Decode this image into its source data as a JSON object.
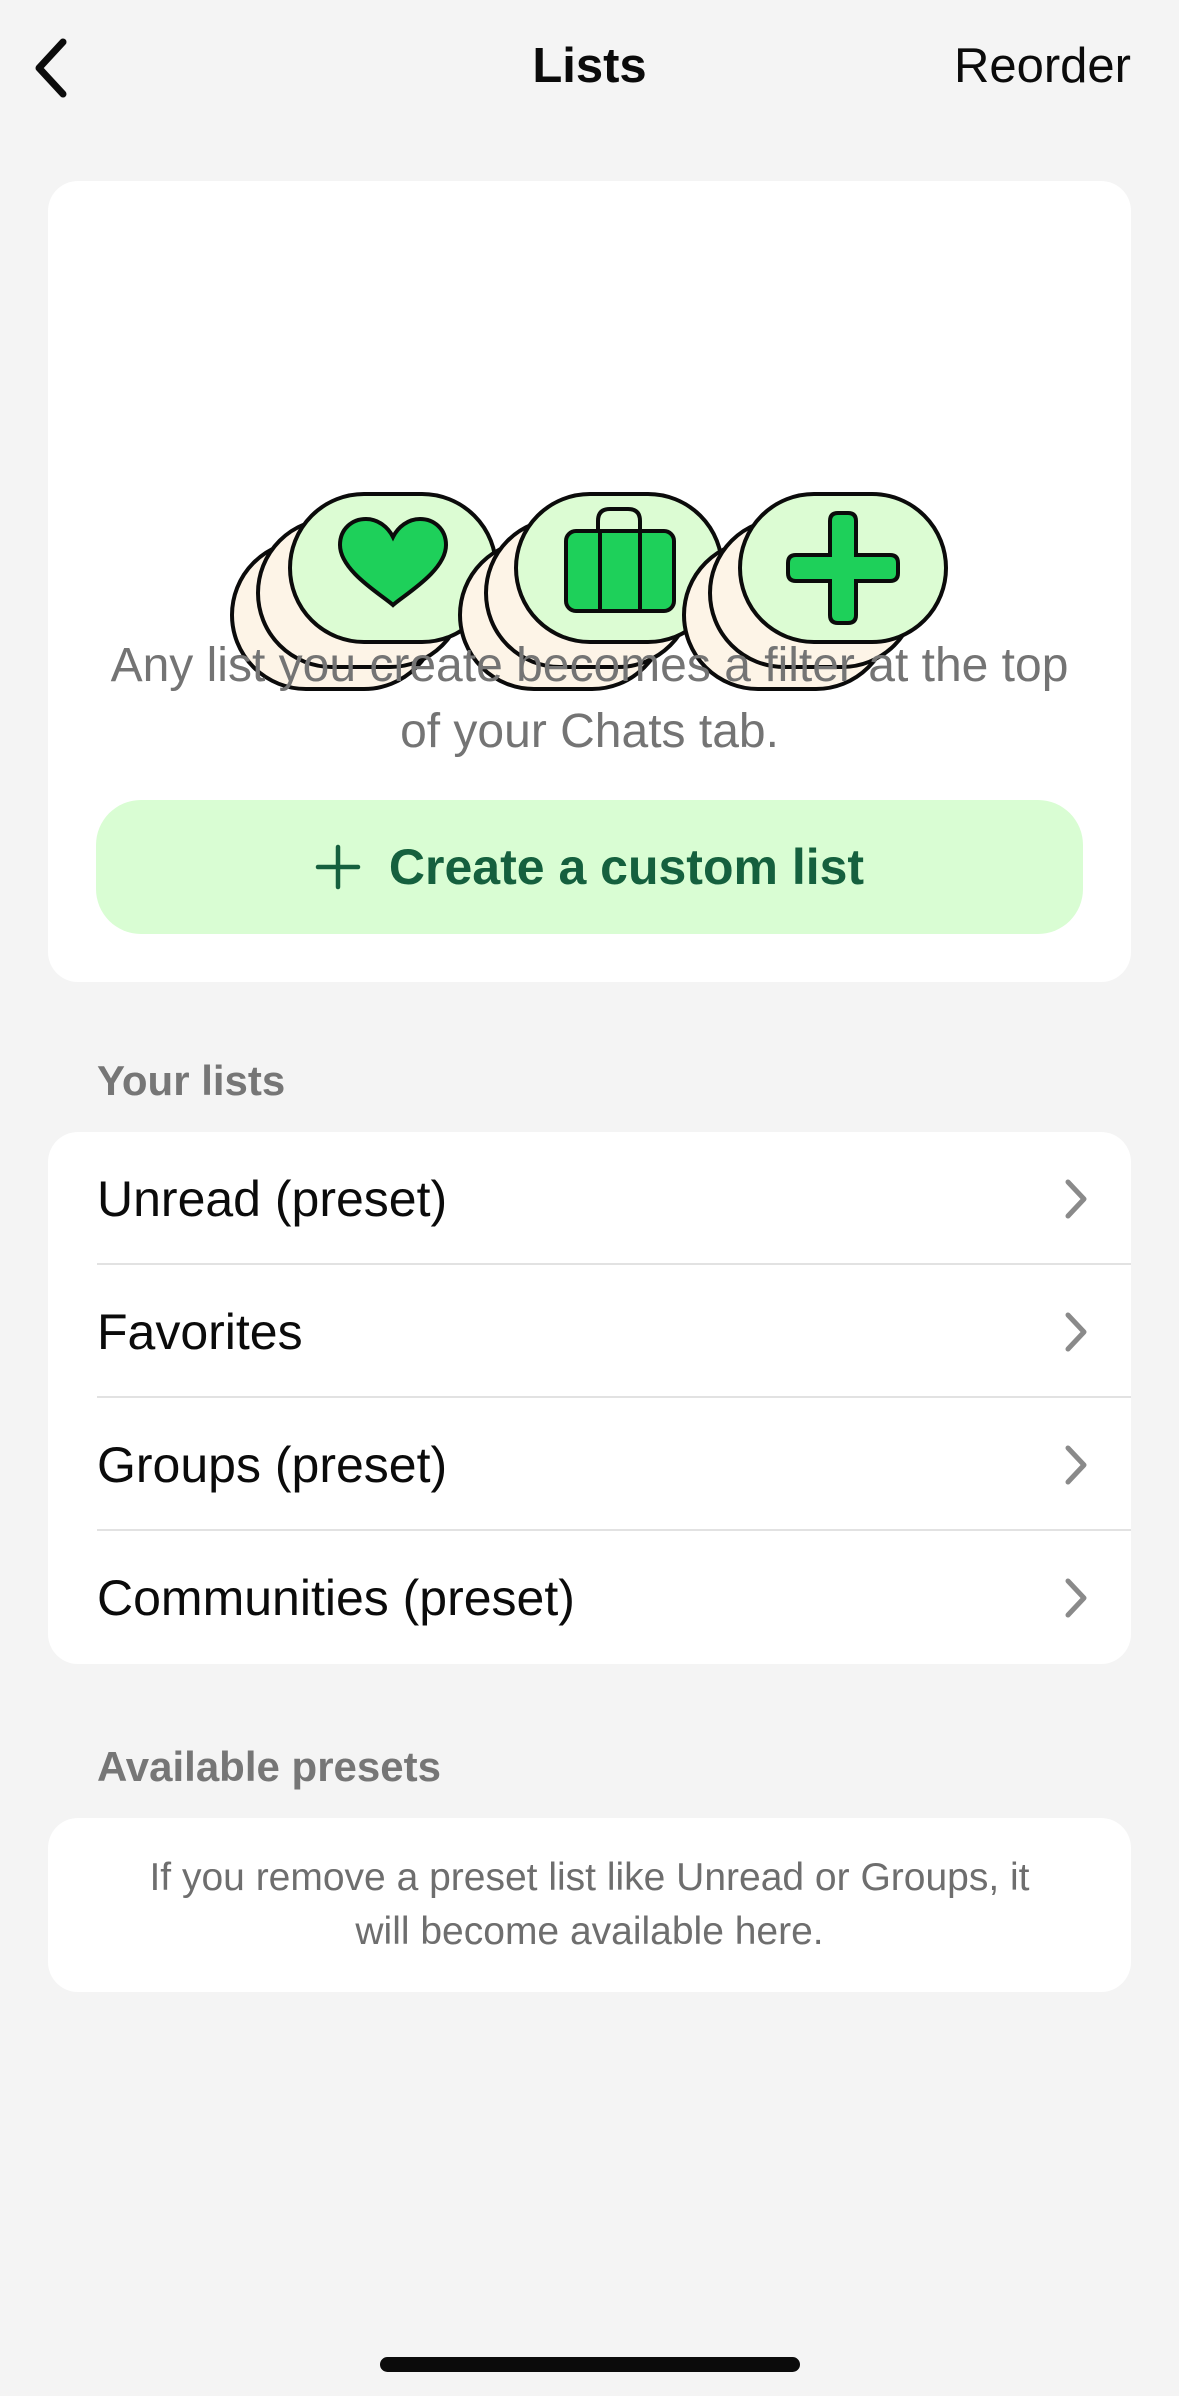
{
  "navbar": {
    "title": "Lists",
    "reorder_label": "Reorder"
  },
  "hero": {
    "illustration_icons": [
      "heart-icon",
      "briefcase-icon",
      "plus-icon"
    ],
    "description": "Any list you create becomes a filter at the top of your Chats tab.",
    "create_button_label": "Create a custom list"
  },
  "your_lists": {
    "header": "Your lists",
    "items": [
      {
        "label": "Unread (preset)"
      },
      {
        "label": "Favorites"
      },
      {
        "label": "Groups (preset)"
      },
      {
        "label": "Communities (preset)"
      }
    ]
  },
  "available_presets": {
    "header": "Available presets",
    "message": "If you remove a preset list like Unread or Groups, it will become available here."
  },
  "colors": {
    "background": "#f4f4f4",
    "card": "#ffffff",
    "accent_green": "#1ed05a",
    "button_bg": "#d9fdd3",
    "button_text": "#15603e",
    "bubble_green": "#dcfcd3",
    "bubble_cream": "#fdf4e7"
  }
}
